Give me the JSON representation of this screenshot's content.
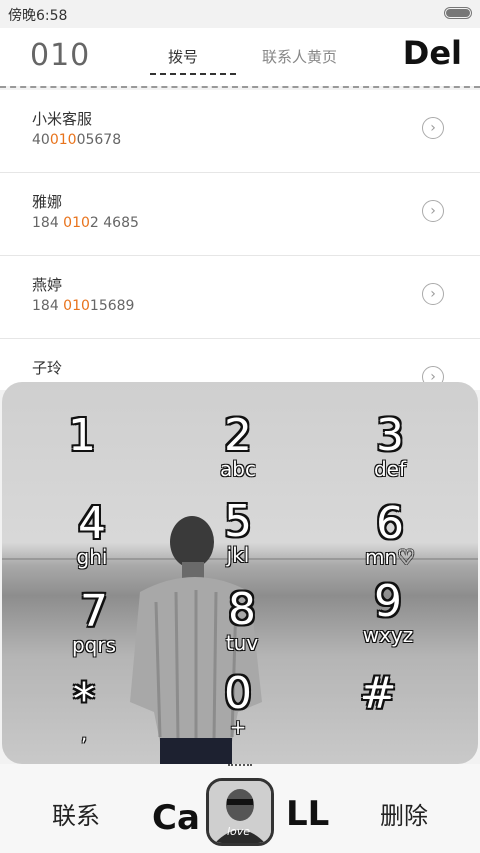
{
  "status": {
    "time": "傍晚6:58"
  },
  "header": {
    "dialed": "010",
    "tab_dial": "拨号",
    "tab_yellow": "联系人黄页",
    "del": "Del"
  },
  "contacts": [
    {
      "name": "小米客服",
      "num_pre": "40",
      "num_hl": "010",
      "num_post": "05678"
    },
    {
      "name": "雅娜",
      "num_pre": "184 ",
      "num_hl": "010",
      "num_post": "2 4685"
    },
    {
      "name": "燕婷",
      "num_pre": "184 ",
      "num_hl": "010",
      "num_post": "15689"
    },
    {
      "name": "子玲",
      "num_pre": "",
      "num_hl": "",
      "num_post": ""
    }
  ],
  "keypad": [
    {
      "digit": "1",
      "letters": ""
    },
    {
      "digit": "2",
      "letters": "abc"
    },
    {
      "digit": "3",
      "letters": "def"
    },
    {
      "digit": "4",
      "letters": "ghi"
    },
    {
      "digit": "5",
      "letters": "jkl"
    },
    {
      "digit": "6",
      "letters": "mn♡"
    },
    {
      "digit": "7",
      "letters": "pqrs"
    },
    {
      "digit": "8",
      "letters": "tuv"
    },
    {
      "digit": "9",
      "letters": "wxyz"
    },
    {
      "digit": "*",
      "letters": ","
    },
    {
      "digit": "0",
      "letters": "+"
    },
    {
      "digit": "#",
      "letters": ""
    }
  ],
  "bottom": {
    "contacts": "联系",
    "call_left": "Ca",
    "call_right": "LL",
    "delete": "删除",
    "avatar_text": "love"
  },
  "icons": {
    "arrow": "chevron-right-icon",
    "battery": "battery-icon"
  }
}
